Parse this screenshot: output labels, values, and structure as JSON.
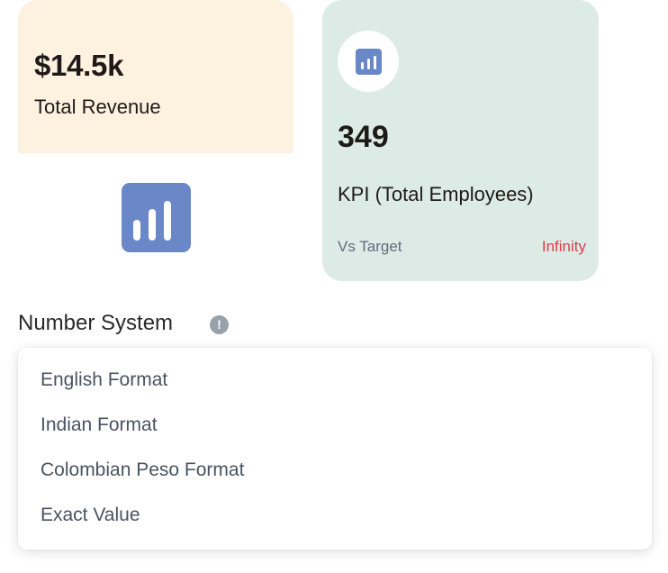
{
  "revenue_card": {
    "value": "$14.5k",
    "label": "Total Revenue",
    "background": "#fdf1df"
  },
  "chart_icon": {
    "name": "bar-chart-icon",
    "color": "#6a88c8"
  },
  "kpi_card": {
    "icon": "bar-chart-icon",
    "value": "349",
    "label": "KPI (Total Employees)",
    "vs_label": "Vs Target",
    "target_value": "Infinity",
    "background": "#dcebe6",
    "target_color": "#e23b4a"
  },
  "number_system": {
    "label": "Number System",
    "info_icon": "info-icon",
    "info_glyph": "!",
    "options": [
      "English Format",
      "Indian Format",
      "Colombian Peso Format",
      "Exact Value"
    ]
  }
}
